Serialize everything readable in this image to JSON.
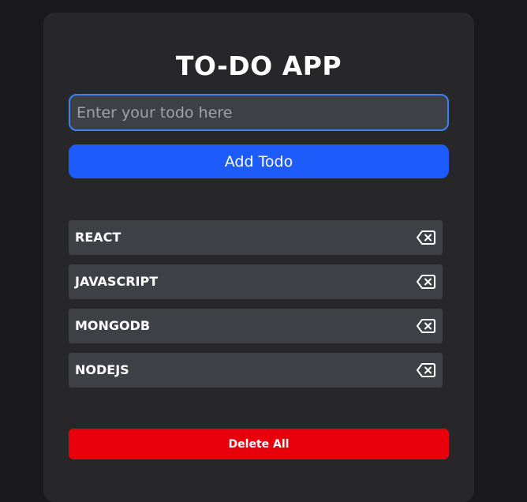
{
  "app": {
    "title": "TO-DO APP"
  },
  "input": {
    "placeholder": "Enter your todo here",
    "value": ""
  },
  "buttons": {
    "add_label": "Add Todo",
    "delete_all_label": "Delete All"
  },
  "todos": [
    {
      "text": "REACT",
      "icon": "backspace-delete-icon"
    },
    {
      "text": "JAVASCRIPT",
      "icon": "backspace-delete-icon"
    },
    {
      "text": "MONGODB",
      "icon": "backspace-delete-icon"
    },
    {
      "text": "NODEJS",
      "icon": "backspace-delete-icon"
    }
  ],
  "colors": {
    "page_background": "#19191b",
    "card_background": "#27272a",
    "input_background": "#3f3f46",
    "input_border": "#3b82f6",
    "add_button": "#1d5cfb",
    "todo_item_background": "#3f3f46",
    "delete_all_button": "#e7000b",
    "text": "#ffffff"
  }
}
